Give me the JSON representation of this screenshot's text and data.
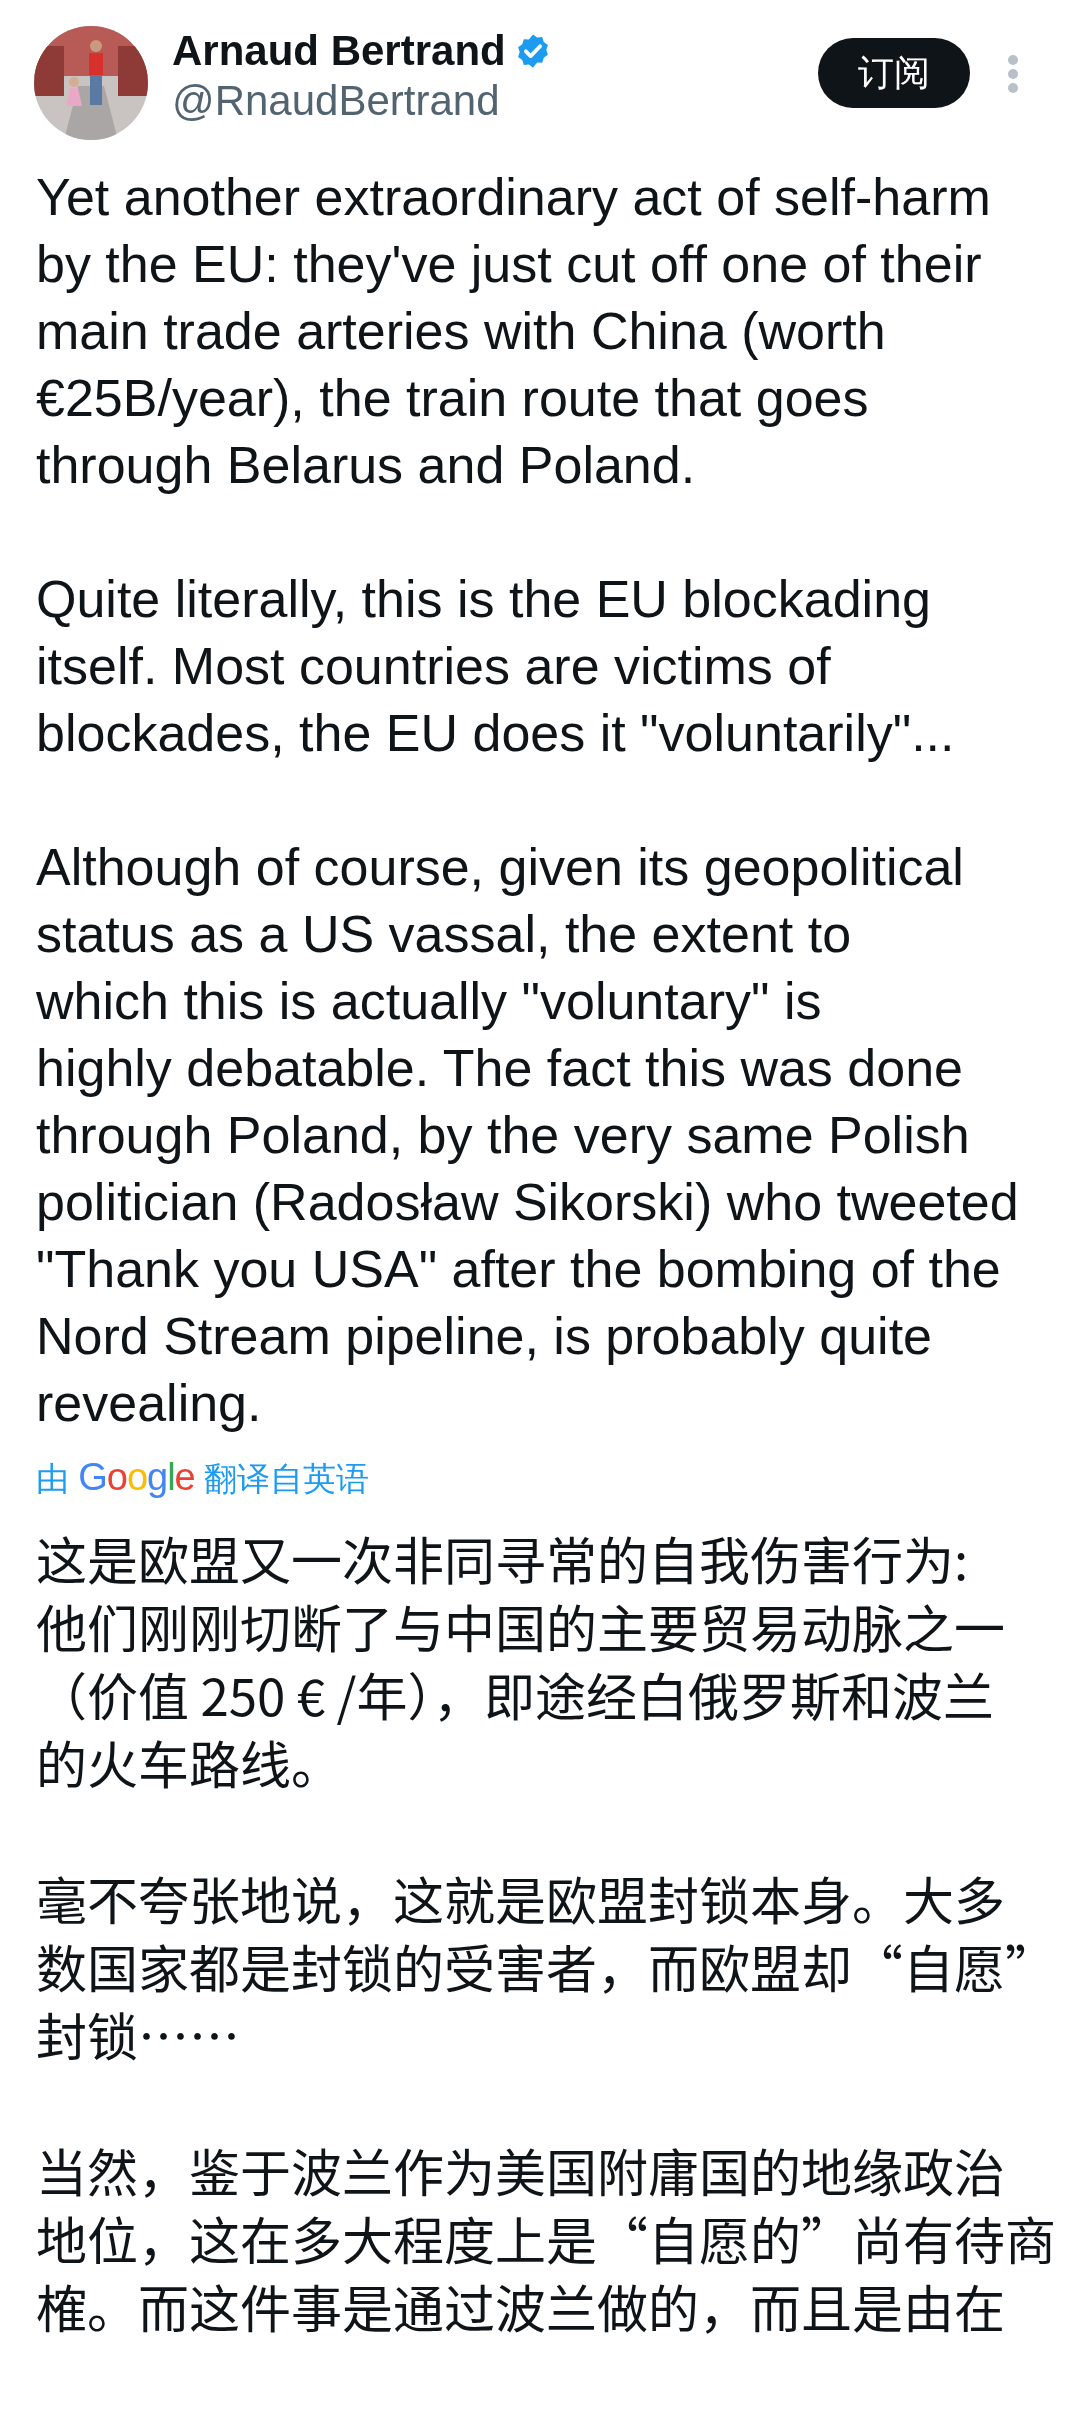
{
  "author": {
    "name": "Arnaud Bertrand",
    "verified": true,
    "handle": "@RnaudBertrand"
  },
  "subscribe_button": {
    "label": "订阅"
  },
  "tweet_text": [
    {
      "lines": [
        "Yet another extraordinary act of self-harm",
        "by the EU: they've just cut off one of their",
        "main trade arteries with China (worth",
        "€25B/year), the train route that goes",
        "through Belarus and Poland."
      ]
    },
    {
      "lines": [
        "Quite literally, this is the EU blockading",
        "itself. Most countries are victims of",
        "blockades, the EU does it \"voluntarily\"..."
      ]
    },
    {
      "lines": [
        "Although of course, given its geopolitical",
        "status as a US vassal, the extent to",
        "which this is actually \"voluntary\" is",
        "highly debatable. The fact this was done",
        "through Poland, by the very same Polish",
        "politician (Radosław Sikorski) who tweeted",
        "\"Thank you USA\" after the bombing of the",
        "Nord Stream pipeline, is probably quite",
        "revealing."
      ]
    }
  ],
  "translation_note": {
    "prefix": "由",
    "brand": "Google",
    "suffix": "翻译自英语"
  },
  "translated_text": [
    {
      "lines": [
        "这是欧盟又一次非同寻常的自我伤害行为:",
        "他们刚刚切断了与中国的主要贸易动脉之一",
        "（价值 250 € /年），即途经白俄罗斯和波兰",
        "的火车路线。"
      ]
    },
    {
      "lines": [
        "毫不夸张地说，这就是欧盟封锁本身。大多",
        "数国家都是封锁的受害者，而欧盟却“自愿”",
        "封锁……"
      ]
    },
    {
      "lines": [
        "当然，鉴于波兰作为美国附庸国的地缘政治",
        "地位，这在多大程度上是“自愿的”尚有待商",
        "榷。而这件事是通过波兰做的，而且是由在"
      ]
    }
  ]
}
